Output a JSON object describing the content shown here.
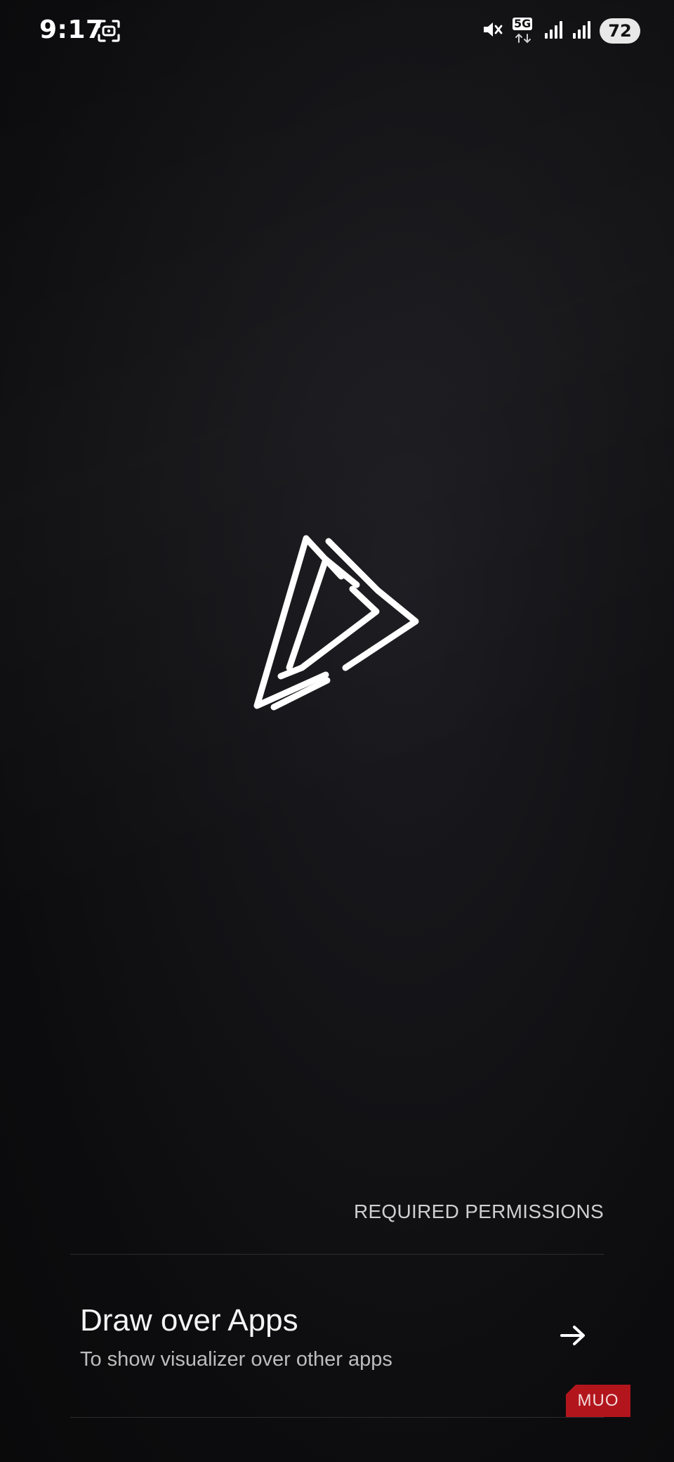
{
  "status_bar": {
    "time": "9:17",
    "network_label": "5G",
    "battery_level": "72",
    "icons": [
      "screenshot-icon",
      "mute-icon",
      "5g-icon",
      "signal-icon",
      "signal-icon",
      "battery-icon"
    ]
  },
  "app": {
    "logo": "triangle-play-logo"
  },
  "permissions": {
    "header": "REQUIRED PERMISSIONS",
    "items": [
      {
        "title": "Draw over Apps",
        "description": "To show visualizer over other apps",
        "icon": "arrow-right-icon"
      }
    ]
  },
  "watermark": {
    "text": "MUO",
    "color": "#b3151c"
  }
}
